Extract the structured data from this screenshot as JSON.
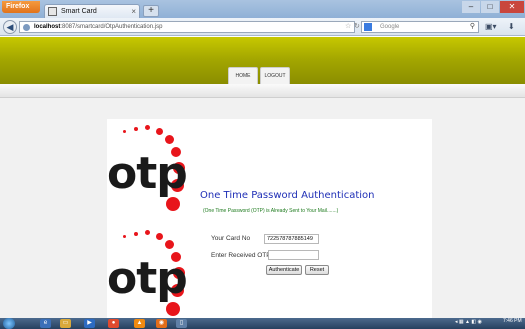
{
  "browser": {
    "app_button_label": "Firefox",
    "tab_title": "Smart Card",
    "url_host": "localhost",
    "url_path": ":8087/smartcard/OtpAuthentication.jsp",
    "search_placeholder": "Google",
    "new_tab_label": "+",
    "tab_close_label": "×"
  },
  "site": {
    "nav": {
      "home": "HOME",
      "logout": "LOGOUT"
    },
    "logo_text": "otp",
    "heading": "One Time Password Authentication",
    "subheading": "(One Time Password (OTP) is Already Sent to Your Mail.......)",
    "form": {
      "card_label": "Your Card No",
      "card_value": "722578787885149",
      "otp_label": "Enter Received OTP",
      "otp_value": "",
      "authenticate_button": "Authenticate",
      "reset_button": "Reset"
    }
  },
  "taskbar": {
    "clock": "7:46 PM",
    "icons": [
      "ie-icon",
      "folder-icon",
      "media-player-icon",
      "chrome-icon",
      "vlc-icon",
      "firefox-icon",
      "app-icon"
    ]
  },
  "colors": {
    "header_olive": "#a5a800",
    "heading_blue": "#1f2fb6",
    "subheading_green": "#1d7a1d",
    "logo_red": "#e8151b"
  }
}
